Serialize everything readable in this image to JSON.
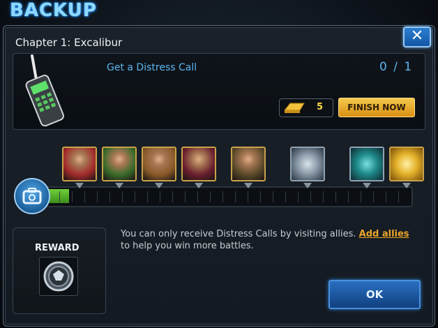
{
  "header": {
    "title": "BACKUP"
  },
  "dialog": {
    "chapter_title": "Chapter 1: Excalibur",
    "close_label": "✕"
  },
  "mission": {
    "name": "Get a Distress Call",
    "progress": "0 / 1",
    "gold_cost": "5",
    "finish_label": "FINISH NOW"
  },
  "track": {
    "fill_fraction": 0.06,
    "slots": [
      {
        "name": "hero-portrait-1",
        "type": "hero",
        "color": "#a32b2b"
      },
      {
        "name": "hero-portrait-2",
        "type": "hero",
        "color": "#3a6b2a"
      },
      {
        "name": "hero-portrait-3",
        "type": "hero",
        "color": "#8a5a2a"
      },
      {
        "name": "hero-portrait-4",
        "type": "hero",
        "color": "#6b1f2f"
      },
      {
        "name": "hero-portrait-5",
        "type": "hero",
        "color": "#5a4a2a"
      },
      {
        "name": "silver-coins-icon",
        "type": "silver",
        "color": "#8fa3b4"
      },
      {
        "name": "teal-crate-icon",
        "type": "teal",
        "color": "#1f8a8a"
      },
      {
        "name": "gold-bars-icon",
        "type": "gold",
        "color": "#e5b32a"
      }
    ]
  },
  "reward": {
    "label": "REWARD",
    "icon": "shield-emblem-icon"
  },
  "info": {
    "text_before": "You can only receive Distress Calls by visiting allies. ",
    "link_text": "Add allies",
    "text_after": " to help you win more battles."
  },
  "ok_label": "OK"
}
